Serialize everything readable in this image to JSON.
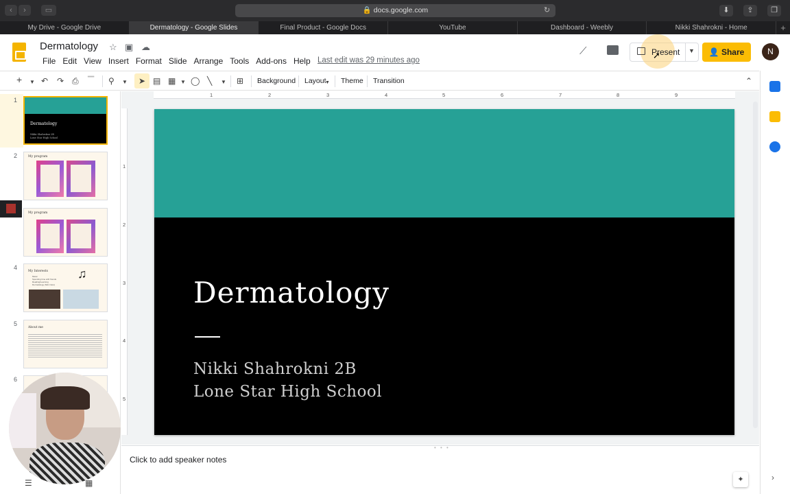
{
  "browser": {
    "url": "docs.google.com",
    "tabs": [
      {
        "label": "My Drive - Google Drive",
        "active": false
      },
      {
        "label": "Dermatology - Google Slides",
        "active": true
      },
      {
        "label": "Final Product - Google Docs",
        "active": false
      },
      {
        "label": "YouTube",
        "active": false
      },
      {
        "label": "Dashboard - Weebly",
        "active": false
      },
      {
        "label": "Nikki Shahrokni - Home",
        "active": false
      }
    ],
    "new_tab": "+"
  },
  "header": {
    "title": "Dermatology",
    "menu": [
      "File",
      "Edit",
      "View",
      "Insert",
      "Format",
      "Slide",
      "Arrange",
      "Tools",
      "Add-ons",
      "Help"
    ],
    "last_edit": "Last edit was 29 minutes ago",
    "present_label": "Present",
    "share_label": "Share",
    "avatar_initial": "N"
  },
  "toolbar": {
    "background": "Background",
    "layout": "Layout",
    "theme": "Theme",
    "transition": "Transition"
  },
  "rulers": {
    "top": [
      "1",
      "2",
      "3",
      "4",
      "5",
      "6",
      "7",
      "8",
      "9"
    ],
    "left": [
      "1",
      "2",
      "3",
      "4",
      "5"
    ]
  },
  "filmstrip": {
    "slides": [
      {
        "num": "1",
        "title": "Dermatology",
        "lines": [
          "Nikki Shahrokni 2B",
          "Lone Star High School"
        ]
      },
      {
        "num": "2",
        "title": "My program"
      },
      {
        "num": "3",
        "title": "My program"
      },
      {
        "num": "4",
        "title": "My Interests",
        "lines": [
          "Music",
          "Spending time with friends",
          "Reading/Learning",
          "Dermatology (Skin Care)"
        ]
      },
      {
        "num": "5",
        "title": "About me"
      },
      {
        "num": "6",
        "title": ""
      }
    ]
  },
  "slide": {
    "title": "Dermatology",
    "subtitle_line1": "Nikki Shahrokni 2B",
    "subtitle_line2": "Lone Star High School"
  },
  "notes": {
    "placeholder": "Click to add speaker notes"
  },
  "colors": {
    "accent_band": "#26a196",
    "share": "#fbbc04",
    "slides_logo": "#f4b400"
  }
}
